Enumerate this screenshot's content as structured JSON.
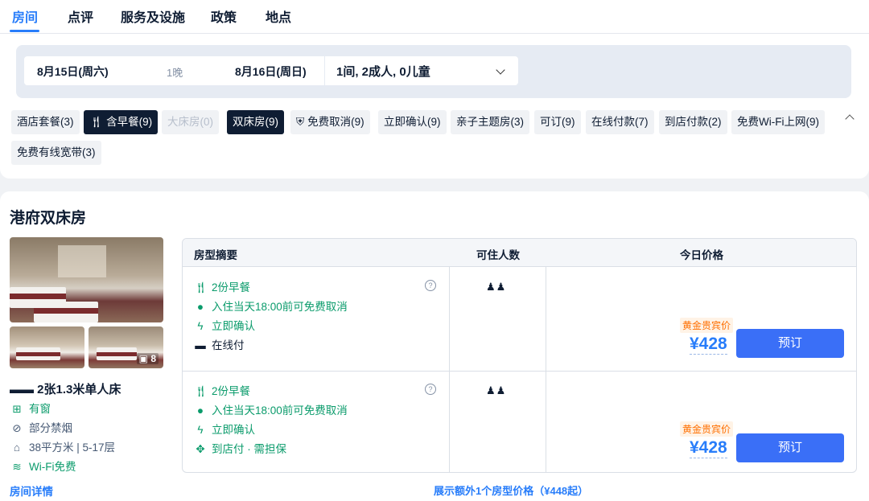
{
  "tabs": [
    "房间",
    "点评",
    "服务及设施",
    "政策",
    "地点"
  ],
  "search": {
    "checkin": "8月15日(周六)",
    "nights": "1晚",
    "checkout": "8月16日(周日)",
    "guests": "1间, 2成人, 0儿童"
  },
  "filters": [
    {
      "label": "酒店套餐(3)",
      "state": "normal"
    },
    {
      "label": "含早餐(9)",
      "state": "selected",
      "icon": "utensils-icon"
    },
    {
      "label": "大床房(0)",
      "state": "disabled"
    },
    {
      "label": "双床房(9)",
      "state": "selected"
    },
    {
      "label": "免费取消(9)",
      "state": "normal",
      "icon": "shield-icon"
    },
    {
      "label": "立即确认(9)",
      "state": "normal"
    },
    {
      "label": "亲子主题房(3)",
      "state": "normal"
    },
    {
      "label": "可订(9)",
      "state": "normal"
    },
    {
      "label": "在线付款(7)",
      "state": "normal"
    },
    {
      "label": "到店付款(2)",
      "state": "normal"
    },
    {
      "label": "免费Wi-Fi上网(9)",
      "state": "normal"
    },
    {
      "label": "免费有线宽带(3)",
      "state": "normal"
    }
  ],
  "room": {
    "name": "港府双床房",
    "photo_count": "8",
    "bed": "2张1.3米单人床",
    "features": [
      {
        "text": "有窗",
        "icon": "window-icon",
        "green": true
      },
      {
        "text": "部分禁烟",
        "icon": "no-smoking-icon",
        "green": false
      },
      {
        "text": "38平方米 | 5-17层",
        "icon": "area-icon",
        "green": false
      },
      {
        "text": "Wi-Fi免费",
        "icon": "wifi-icon",
        "green": true
      }
    ],
    "detail_link": "房间详情"
  },
  "table": {
    "headers": [
      "房型摘要",
      "可住人数",
      "今日价格"
    ],
    "rates": [
      {
        "items": [
          {
            "text": "2份早餐",
            "icon": "utensils-icon",
            "green": true
          },
          {
            "text": "入住当天18:00前可免费取消",
            "icon": "check-circle-icon",
            "green": true
          },
          {
            "text": "立即确认",
            "icon": "lightning-icon",
            "green": true
          },
          {
            "text": "在线付",
            "icon": "card-icon",
            "green": false
          }
        ],
        "occupancy": "2",
        "tag": "黄金贵宾价",
        "price": "¥428",
        "button": "预订"
      },
      {
        "items": [
          {
            "text": "2份早餐",
            "icon": "utensils-icon",
            "green": true
          },
          {
            "text": "入住当天18:00前可免费取消",
            "icon": "check-circle-icon",
            "green": true
          },
          {
            "text": "立即确认",
            "icon": "lightning-icon",
            "green": true
          },
          {
            "text": "到店付 · 需担保",
            "icon": "pay-at-hotel-icon",
            "green": true
          }
        ],
        "occupancy": "2",
        "tag": "黄金贵宾价",
        "price": "¥428",
        "button": "预订"
      }
    ],
    "more_link": "展示额外1个房型价格（¥448起）"
  },
  "colors": {
    "accent": "#287dfa",
    "green": "#0a9b6b",
    "button": "#3a6ff7",
    "tag": "#ff6f00",
    "dark_chip": "#0f1d33"
  }
}
